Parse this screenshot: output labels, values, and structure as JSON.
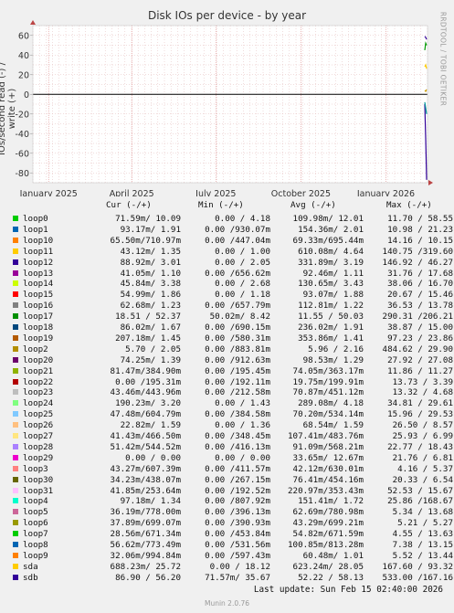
{
  "graph": {
    "title": "Disk IOs per device - by year",
    "ylabel": "IOs/second read (-) / write (+)",
    "side_label": "RRDTOOL / TOBI OETIKER",
    "headers": {
      "cur": "Cur (-/+)",
      "min": "Min (-/+)",
      "avg": "Avg (-/+)",
      "max": "Max (-/+)"
    },
    "last_update": "Last update: Sun Feb 15 02:40:00 2026",
    "footer": "Munin 2.0.76"
  },
  "chart_data": {
    "type": "line",
    "title": "Disk IOs per device - by year",
    "ylabel": "IOs/second read (-) / write (+)",
    "ylim": [
      -90,
      70
    ],
    "yticks": [
      "60",
      "40",
      "20",
      "0",
      "-20",
      "-40",
      "-60",
      "-80"
    ],
    "ytick_values": [
      60,
      40,
      20,
      0,
      -20,
      -40,
      -60,
      -80
    ],
    "xticks": [
      "January 2025",
      "April 2025",
      "July 2025",
      "October 2025",
      "January 2026"
    ],
    "grid": true,
    "colors": {
      "background": "#ffffff",
      "grid_minor": "#e3b8b8",
      "axis": "#000000"
    },
    "series": [
      {
        "name": "sda",
        "color": "#ffcc00",
        "x": [
          "2026-02-12",
          "2026-02-13",
          "2026-02-14"
        ],
        "values": [
          28,
          30,
          26
        ]
      },
      {
        "name": "loop5",
        "color": "#009900",
        "x": [
          "2026-02-12",
          "2026-02-13",
          "2026-02-14"
        ],
        "values": [
          45,
          52,
          50
        ]
      },
      {
        "name": "sdb",
        "color": "#330099",
        "x": [
          "2026-02-12",
          "2026-02-13",
          "2026-02-14"
        ],
        "values": [
          59,
          58,
          56
        ]
      },
      {
        "name": "loop9",
        "color": "#cc9900",
        "x": [
          "2026-02-12",
          "2026-02-13",
          "2026-02-14"
        ],
        "values": [
          4,
          3,
          5
        ]
      },
      {
        "name": "sdb",
        "color": "#330099",
        "x": [
          "2026-02-12",
          "2026-02-13",
          "2026-02-14"
        ],
        "values": [
          -10,
          -45,
          -87
        ]
      },
      {
        "name": "loop7",
        "color": "#009999",
        "x": [
          "2026-02-12",
          "2026-02-13",
          "2026-02-14"
        ],
        "values": [
          -8,
          -14,
          -20
        ]
      }
    ]
  },
  "legend": [
    {
      "name": "loop0",
      "color": "#00cc00",
      "cur": "71.59m/ 10.09",
      "min": "0.00 / 4.18",
      "avg": "109.98m/ 12.01",
      "max": "11.70 / 58.55"
    },
    {
      "name": "loop1",
      "color": "#0066b3",
      "cur": "93.17m/ 1.91",
      "min": "0.00 /930.07m",
      "avg": "154.36m/ 2.01",
      "max": "10.98 / 21.23"
    },
    {
      "name": "loop10",
      "color": "#ff8000",
      "cur": "65.50m/710.97m",
      "min": "0.00 /447.04m",
      "avg": "69.33m/695.44m",
      "max": "14.16 / 10.15"
    },
    {
      "name": "loop11",
      "color": "#ffcc00",
      "cur": "43.12m/ 1.35",
      "min": "0.00 / 1.00",
      "avg": "610.08m/ 4.64",
      "max": "140.75 /319.60"
    },
    {
      "name": "loop12",
      "color": "#330099",
      "cur": "88.92m/ 3.01",
      "min": "0.00 / 2.05",
      "avg": "331.89m/ 3.19",
      "max": "146.92 / 46.27"
    },
    {
      "name": "loop13",
      "color": "#990099",
      "cur": "41.05m/ 1.10",
      "min": "0.00 /656.62m",
      "avg": "92.46m/ 1.11",
      "max": "31.76 / 17.68"
    },
    {
      "name": "loop14",
      "color": "#ccff00",
      "cur": "45.84m/ 3.38",
      "min": "0.00 / 2.68",
      "avg": "130.65m/ 3.43",
      "max": "38.06 / 16.70"
    },
    {
      "name": "loop15",
      "color": "#ff0000",
      "cur": "54.99m/ 1.86",
      "min": "0.00 / 1.18",
      "avg": "93.07m/ 1.88",
      "max": "20.67 / 15.46"
    },
    {
      "name": "loop16",
      "color": "#808080",
      "cur": "62.68m/ 1.23",
      "min": "0.00 /657.79m",
      "avg": "112.81m/ 1.22",
      "max": "36.53 / 13.78"
    },
    {
      "name": "loop17",
      "color": "#008f00",
      "cur": "18.51 / 52.37",
      "min": "50.02m/ 8.42",
      "avg": "11.55 / 50.03",
      "max": "290.31 /206.21"
    },
    {
      "name": "loop18",
      "color": "#00487d",
      "cur": "86.02m/ 1.67",
      "min": "0.00 /690.15m",
      "avg": "236.02m/ 1.91",
      "max": "38.87 / 15.00"
    },
    {
      "name": "loop19",
      "color": "#b35a00",
      "cur": "207.18m/ 1.45",
      "min": "0.00 /580.31m",
      "avg": "353.86m/ 1.41",
      "max": "97.23 / 23.86"
    },
    {
      "name": "loop2",
      "color": "#b38f00",
      "cur": "5.70 / 2.05",
      "min": "0.00 /883.81m",
      "avg": "5.96 / 2.16",
      "max": "484.62 / 29.90"
    },
    {
      "name": "loop20",
      "color": "#6b006b",
      "cur": "74.25m/ 1.39",
      "min": "0.00 /912.63m",
      "avg": "98.53m/ 1.29",
      "max": "27.92 / 27.08"
    },
    {
      "name": "loop21",
      "color": "#8fb300",
      "cur": "81.47m/384.90m",
      "min": "0.00 /195.45m",
      "avg": "74.05m/363.17m",
      "max": "11.86 / 11.27"
    },
    {
      "name": "loop22",
      "color": "#b30000",
      "cur": "0.00 /195.31m",
      "avg": "19.75m/199.91m",
      "min": "0.00 /192.11m",
      "max": "13.73 / 3.39"
    },
    {
      "name": "loop23",
      "color": "#bebebe",
      "cur": "43.46m/443.96m",
      "min": "0.00 /212.58m",
      "avg": "70.87m/451.12m",
      "max": "13.32 / 4.68"
    },
    {
      "name": "loop24",
      "color": "#80ff80",
      "cur": "190.23m/ 3.20",
      "min": "0.00 / 1.43",
      "avg": "289.08m/ 4.18",
      "max": "34.81 / 29.61"
    },
    {
      "name": "loop25",
      "color": "#80c9ff",
      "cur": "47.48m/604.79m",
      "min": "0.00 /384.58m",
      "avg": "70.20m/534.14m",
      "max": "15.96 / 29.53"
    },
    {
      "name": "loop26",
      "color": "#ffc080",
      "cur": "22.82m/ 1.59",
      "min": "0.00 / 1.36",
      "avg": "68.54m/ 1.59",
      "max": "26.50 / 8.57"
    },
    {
      "name": "loop27",
      "color": "#ffe680",
      "cur": "41.43m/466.50m",
      "min": "0.00 /348.45m",
      "avg": "107.41m/483.76m",
      "max": "25.93 / 6.99"
    },
    {
      "name": "loop28",
      "color": "#aa80ff",
      "cur": "51.42m/544.52m",
      "min": "0.00 /416.13m",
      "avg": "91.09m/568.21m",
      "max": "22.77 / 18.43"
    },
    {
      "name": "loop29",
      "color": "#ee00cc",
      "cur": "0.00 / 0.00",
      "min": "0.00 / 0.00",
      "avg": "33.65m/ 12.67m",
      "max": "21.76 / 6.81"
    },
    {
      "name": "loop3",
      "color": "#ff8080",
      "cur": "43.27m/607.39m",
      "min": "0.00 /411.57m",
      "avg": "42.12m/630.01m",
      "max": "4.16 / 5.37"
    },
    {
      "name": "loop30",
      "color": "#666600",
      "cur": "34.23m/438.07m",
      "min": "0.00 /267.15m",
      "avg": "76.41m/454.16m",
      "max": "20.33 / 6.54"
    },
    {
      "name": "loop31",
      "color": "#ffbfff",
      "cur": "41.85m/253.64m",
      "min": "0.00 /192.52m",
      "avg": "220.97m/353.43m",
      "max": "52.53 / 15.67"
    },
    {
      "name": "loop4",
      "color": "#00ffcc",
      "cur": "97.18m/ 1.34",
      "min": "0.00 /807.92m",
      "avg": "151.41m/ 1.72",
      "max": "25.86 /168.67"
    },
    {
      "name": "loop5",
      "color": "#cc6699",
      "cur": "36.19m/778.00m",
      "min": "0.00 /396.13m",
      "avg": "62.69m/780.98m",
      "max": "5.34 / 13.68"
    },
    {
      "name": "loop6",
      "color": "#999900",
      "cur": "37.89m/699.07m",
      "min": "0.00 /390.93m",
      "avg": "43.29m/699.21m",
      "max": "5.21 / 5.27"
    },
    {
      "name": "loop7",
      "color": "#00cc00",
      "cur": "28.56m/671.34m",
      "min": "0.00 /453.84m",
      "avg": "54.82m/671.59m",
      "max": "4.55 / 13.63"
    },
    {
      "name": "loop8",
      "color": "#0066b3",
      "cur": "56.62m/773.49m",
      "min": "0.00 /531.56m",
      "avg": "100.85m/813.28m",
      "max": "7.38 / 13.15"
    },
    {
      "name": "loop9",
      "color": "#ff8000",
      "cur": "32.06m/994.84m",
      "min": "0.00 /597.43m",
      "avg": "60.48m/ 1.01",
      "max": "5.52 / 13.44"
    },
    {
      "name": "sda",
      "color": "#ffcc00",
      "cur": "688.23m/ 25.72",
      "min": "0.00 / 18.12",
      "avg": "623.24m/ 28.05",
      "max": "167.60 / 93.32"
    },
    {
      "name": "sdb",
      "color": "#330099",
      "cur": "86.90 / 56.20",
      "min": "71.57m/ 35.67",
      "avg": "52.22 / 58.13",
      "max": "533.00 /167.16"
    }
  ]
}
